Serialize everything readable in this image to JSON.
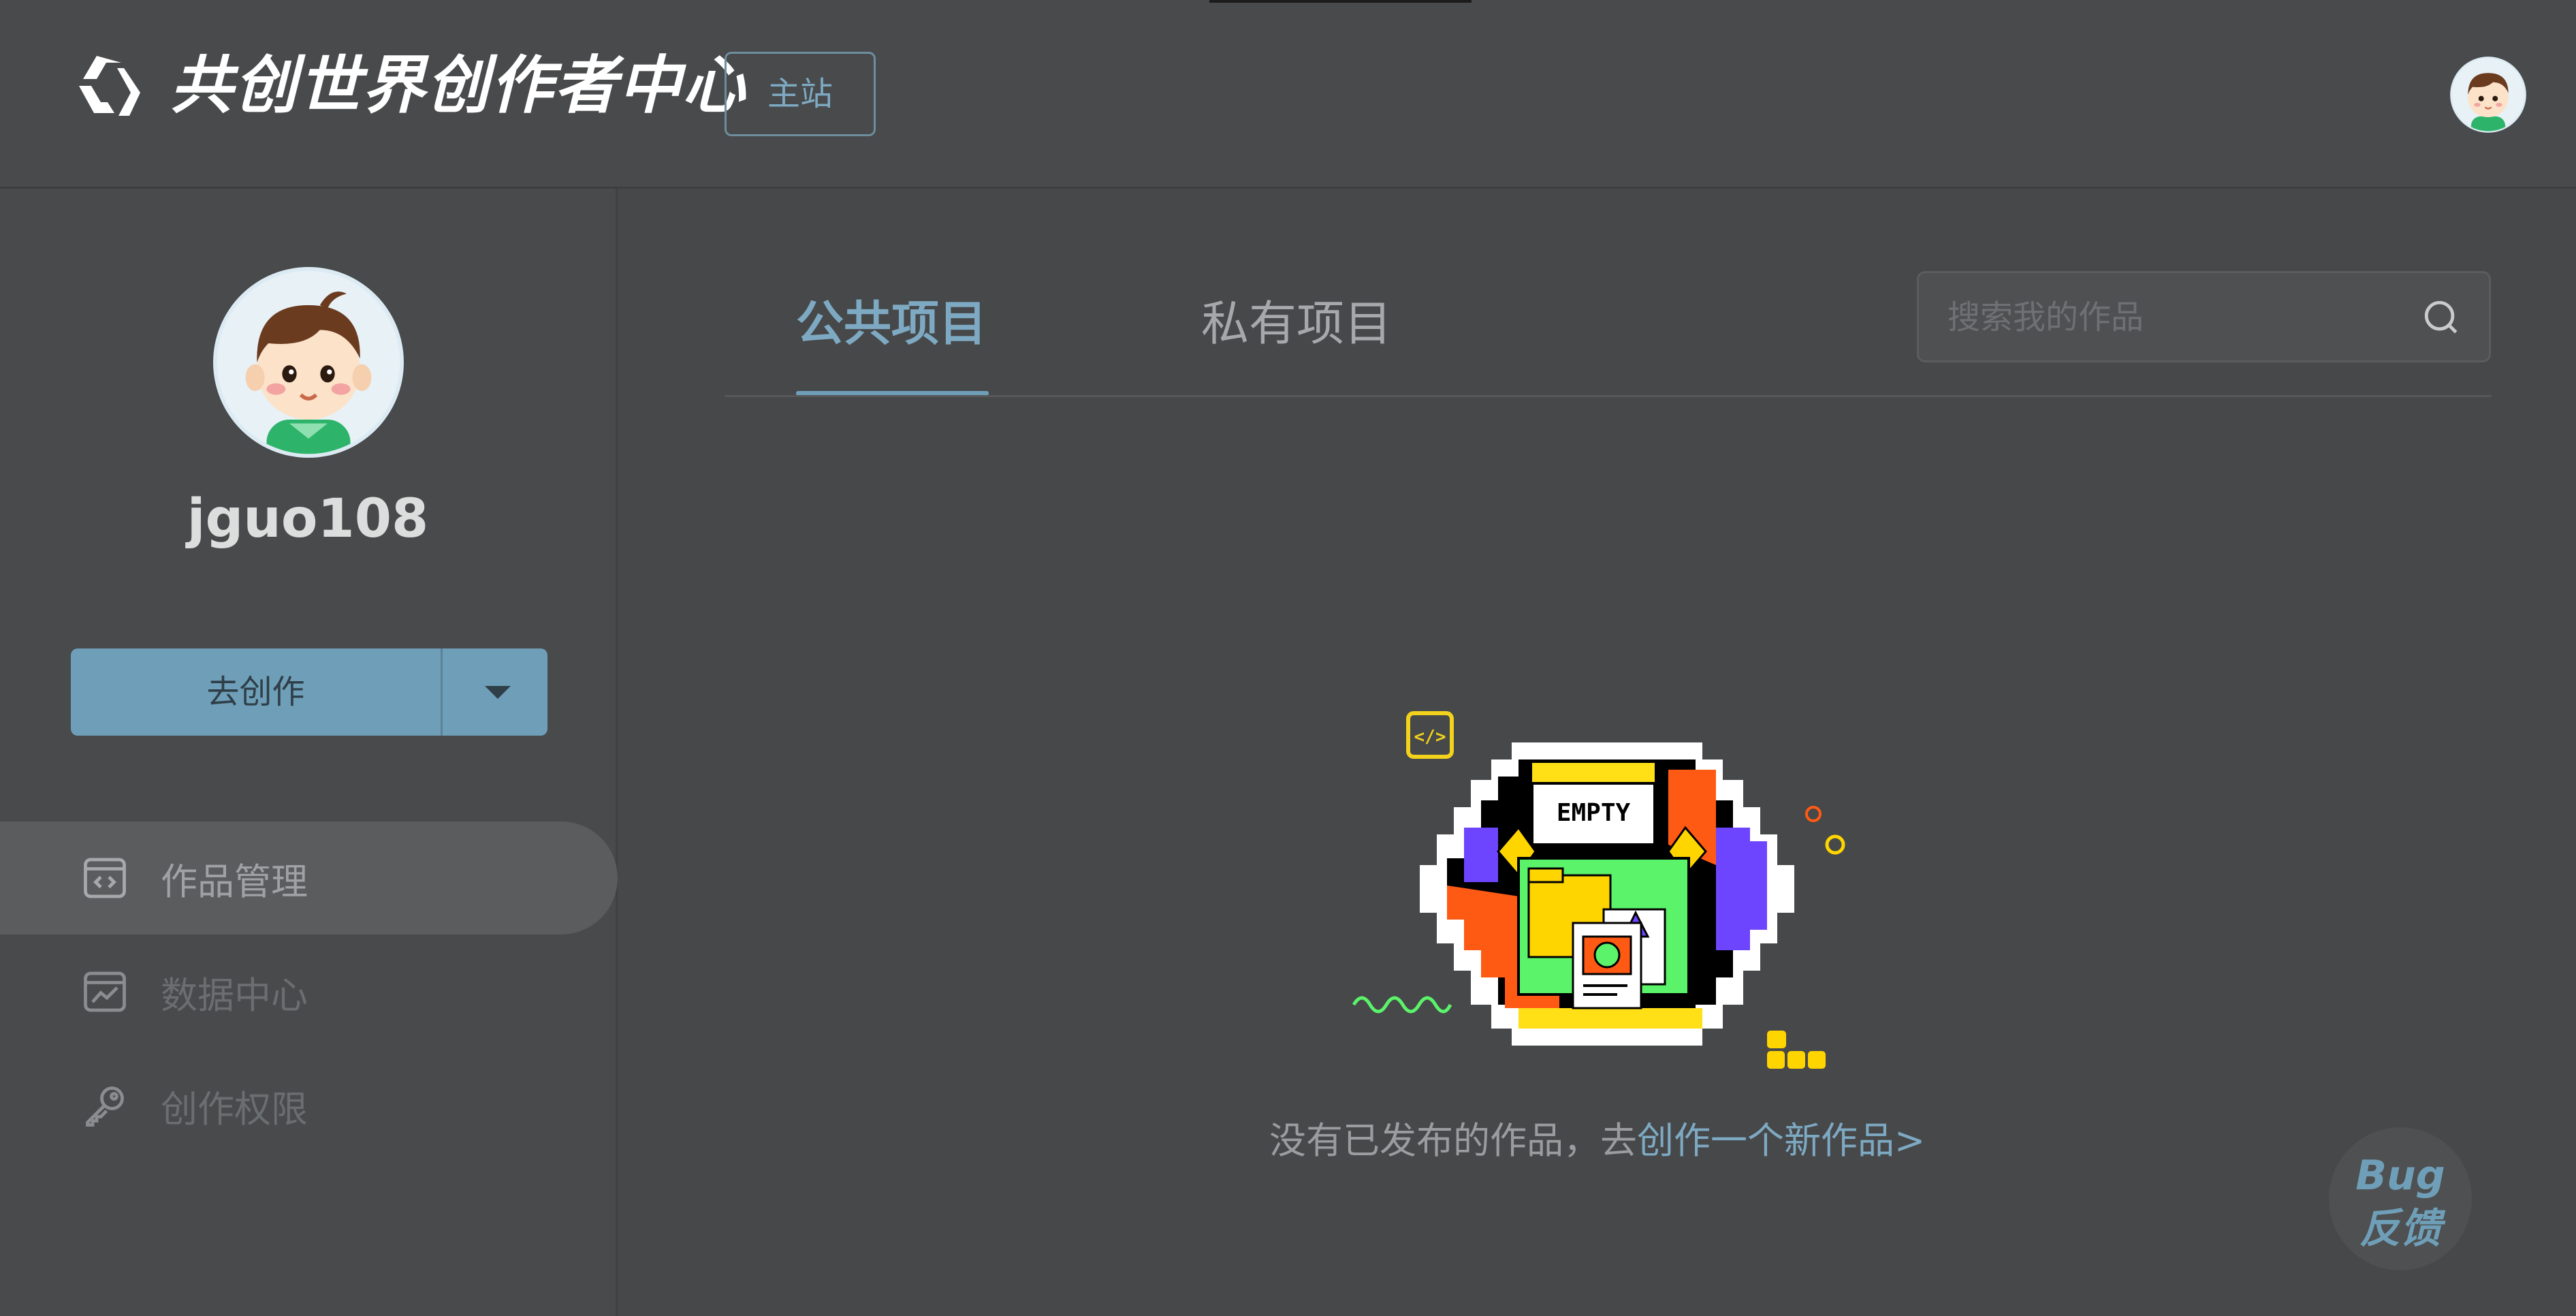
{
  "header": {
    "brand_title": "共创世界创作者中心",
    "main_site_label": "主站"
  },
  "sidebar": {
    "username": "jguo108",
    "create_label": "去创作",
    "nav": [
      {
        "label": "作品管理",
        "icon": "code-window-icon",
        "active": true
      },
      {
        "label": "数据中心",
        "icon": "chart-window-icon",
        "active": false
      },
      {
        "label": "创作权限",
        "icon": "key-icon",
        "active": false
      }
    ]
  },
  "main": {
    "tabs": [
      {
        "label": "公共项目",
        "active": true
      },
      {
        "label": "私有项目",
        "active": false
      }
    ],
    "search": {
      "placeholder": "搜索我的作品"
    },
    "empty": {
      "badge_text": "EMPTY",
      "message_prefix": "没有已发布的作品，去",
      "link_text": "创作一个新作品>"
    }
  },
  "feedback": {
    "line1": "Bug",
    "line2": "反馈"
  },
  "colors": {
    "accent": "#6f9fb8",
    "link": "#7ea9c2",
    "background": "#464849"
  }
}
